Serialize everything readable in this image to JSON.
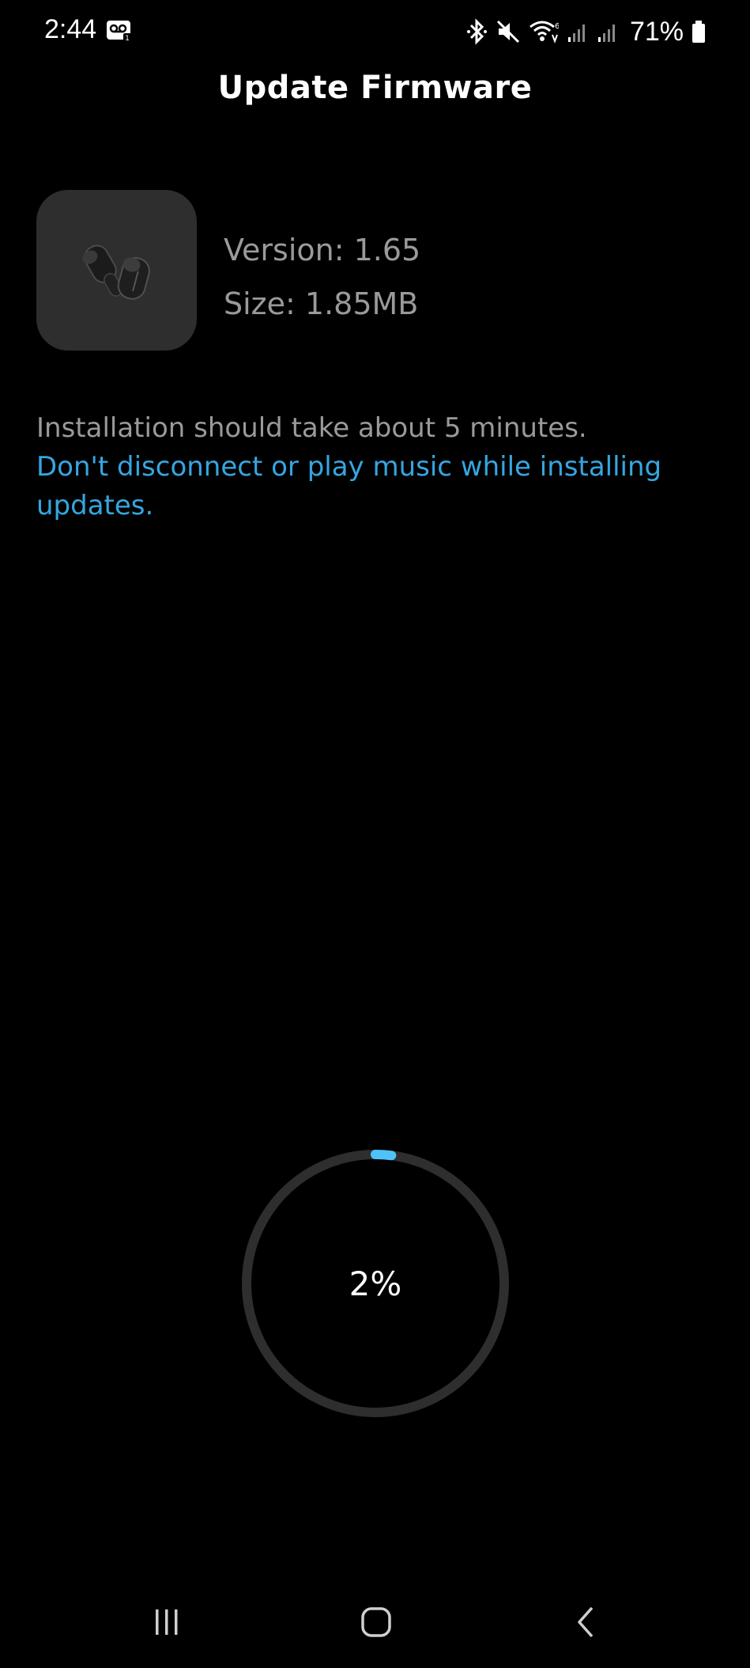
{
  "status_bar": {
    "time": "2:44",
    "battery": "71%",
    "icons": [
      "voicemail-icon",
      "bluetooth-icon",
      "mute-icon",
      "wifi-icon",
      "signal-icon",
      "signal-icon",
      "battery-icon"
    ]
  },
  "header": {
    "title": "Update Firmware"
  },
  "firmware": {
    "image": "earbuds-image",
    "version": "Version: 1.65",
    "size": "Size: 1.85MB"
  },
  "messages": {
    "info": "Installation should take about 5 minutes.",
    "warning": "Don't disconnect or play music while installing updates."
  },
  "progress": {
    "label": "2%",
    "value": 0.02
  },
  "colors": {
    "accent": "#35a6e0",
    "progress_fill": "#4fc3f7",
    "track": "#2e2e2e",
    "muted_text": "#9a9a9a"
  },
  "nav_bar": {
    "buttons": [
      "recents-icon",
      "home-icon",
      "back-icon"
    ]
  }
}
